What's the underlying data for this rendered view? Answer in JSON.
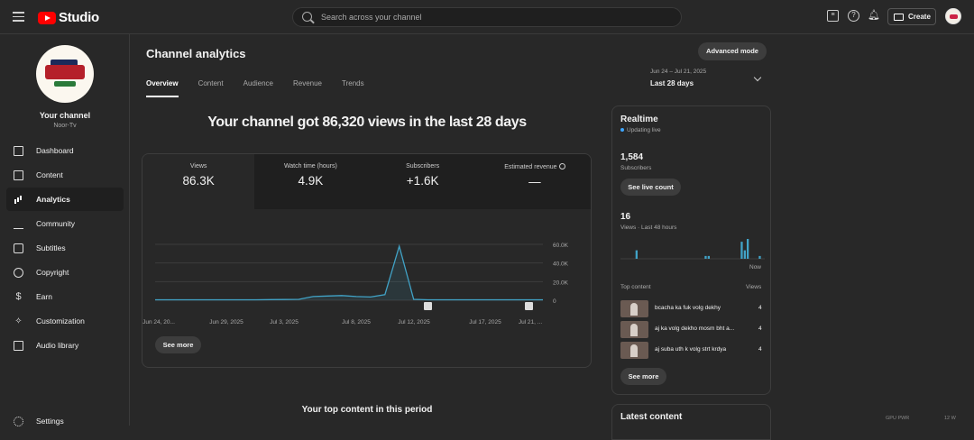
{
  "header": {
    "brand": "Studio",
    "search_placeholder": "Search across your channel",
    "create_label": "Create"
  },
  "sidebar": {
    "channel_label": "Your channel",
    "channel_name": "Noor-Tv",
    "items": [
      {
        "label": "Dashboard",
        "icon": "dashboard-icon"
      },
      {
        "label": "Content",
        "icon": "content-icon"
      },
      {
        "label": "Analytics",
        "icon": "analytics-icon",
        "active": true
      },
      {
        "label": "Community",
        "icon": "community-icon"
      },
      {
        "label": "Subtitles",
        "icon": "subtitles-icon"
      },
      {
        "label": "Copyright",
        "icon": "copyright-icon"
      },
      {
        "label": "Earn",
        "icon": "earn-icon"
      },
      {
        "label": "Customization",
        "icon": "customization-icon"
      },
      {
        "label": "Audio library",
        "icon": "audio-library-icon"
      }
    ],
    "settings_label": "Settings"
  },
  "main": {
    "title": "Channel analytics",
    "advanced_mode": "Advanced mode",
    "tabs": [
      "Overview",
      "Content",
      "Audience",
      "Revenue",
      "Trends"
    ],
    "date_range": "Jun 24 – Jul 21, 2025",
    "date_label": "Last 28 days",
    "headline": "Your channel got 86,320 views in the last 28 days",
    "metrics": [
      {
        "label": "Views",
        "value": "86.3K"
      },
      {
        "label": "Watch time (hours)",
        "value": "4.9K"
      },
      {
        "label": "Subscribers",
        "value": "+1.6K"
      },
      {
        "label": "Estimated revenue",
        "value": "—"
      }
    ],
    "see_more": "See more",
    "top_content_title": "Your top content in this period"
  },
  "chart_data": {
    "type": "line",
    "series": [
      {
        "values": [
          500,
          500,
          500,
          500,
          500,
          500,
          500,
          500,
          700,
          800,
          1000,
          4000,
          4500,
          5000,
          4000,
          3500,
          6000,
          58000,
          1000,
          500,
          500,
          500,
          500,
          500,
          500,
          500,
          500,
          500
        ]
      }
    ],
    "x_tick_labels": [
      "Jun 24, 20...",
      "Jun 29, 2025",
      "Jul 3, 2025",
      "Jul 8, 2025",
      "Jul 12, 2025",
      "Jul 17, 2025",
      "Jul 21, ..."
    ],
    "y_tick_labels": [
      "60.0K",
      "40.0K",
      "20.0K",
      "0"
    ],
    "ylim": [
      0,
      60000
    ],
    "color": "#41a3c7",
    "grid": true
  },
  "realtime": {
    "title": "Realtime",
    "status": "Updating live",
    "subscribers_value": "1,584",
    "subscribers_label": "Subscribers",
    "see_live_count": "See live count",
    "views_value": "16",
    "views_label": "Views · Last 48 hours",
    "now_label": "Now",
    "bars": [
      0,
      0,
      0,
      0,
      0,
      3,
      0,
      0,
      0,
      0,
      0,
      0,
      0,
      0,
      0,
      0,
      0,
      0,
      0,
      0,
      0,
      0,
      0,
      0,
      0,
      0,
      0,
      0,
      1,
      1,
      0,
      0,
      0,
      0,
      0,
      0,
      0,
      0,
      0,
      0,
      6,
      3,
      7,
      0,
      0,
      0,
      1,
      0
    ],
    "top_content_header": "Top content",
    "views_header": "Views",
    "top_content": [
      {
        "title": "bcacha ka fuk volg dekhy",
        "views": "4"
      },
      {
        "title": "aj ka volg dekho mosm bht a...",
        "views": "4"
      },
      {
        "title": "aj suba uth k volg strt krdya",
        "views": "4"
      }
    ],
    "see_more": "See more"
  },
  "latest": {
    "title": "Latest content"
  },
  "overlay": {
    "gpu_label": "GPU PWR",
    "gpu_value": "12 W"
  }
}
